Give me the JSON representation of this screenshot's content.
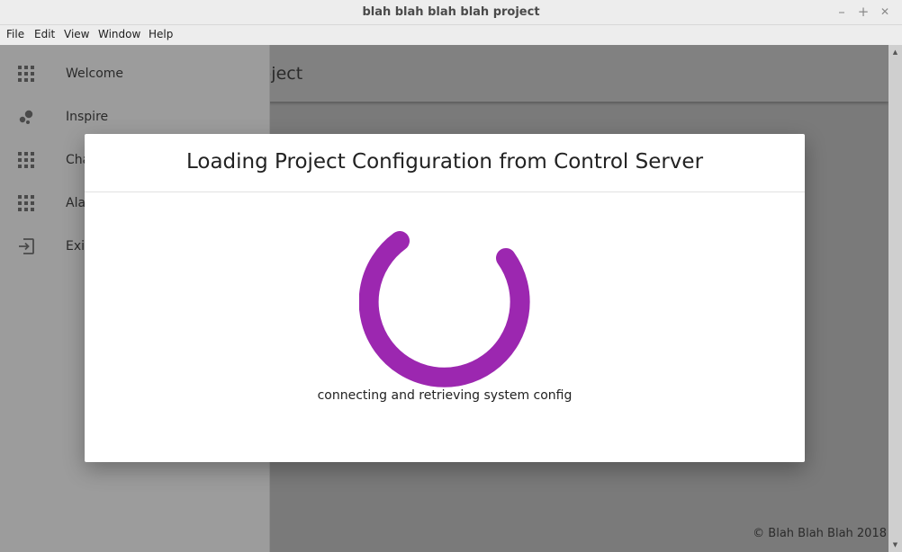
{
  "window": {
    "title": "blah blah blah blah project",
    "controls": {
      "minimize": "–",
      "maximize": "+",
      "close": "✕"
    }
  },
  "menu": [
    "File",
    "Edit",
    "View",
    "Window",
    "Help"
  ],
  "app": {
    "title": "n blah blah project",
    "footer": "© Blah Blah Blah 2018"
  },
  "sidebar": {
    "items": [
      {
        "label": "Welcome",
        "icon": "apps-grid-icon"
      },
      {
        "label": "Inspire",
        "icon": "bubbles-icon"
      },
      {
        "label": "Cha",
        "icon": "apps-grid-icon"
      },
      {
        "label": "Ala",
        "icon": "apps-grid-icon"
      },
      {
        "label": "Exit",
        "icon": "exit-icon"
      }
    ]
  },
  "dialog": {
    "title": "Loading Project Configuration from Control Server",
    "status": "connecting and retrieving system config"
  },
  "colors": {
    "spinner": "#9c27b0",
    "scrim": "#7a7a7a",
    "dialog_bg": "#ffffff"
  }
}
